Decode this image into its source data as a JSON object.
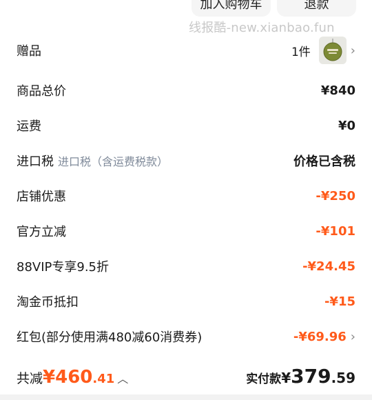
{
  "top_buttons": {
    "add_to_cart": "加入购物车",
    "refund": "退款"
  },
  "watermark": "线报酷-new.xianbao.fun",
  "gift": {
    "label": "赠品",
    "qty": "1件",
    "icon": "gift-ornament-icon"
  },
  "rows": [
    {
      "label": "商品总价",
      "sub": "",
      "value": "¥840",
      "highlight": false
    },
    {
      "label": "运费",
      "sub": "",
      "value": "¥0",
      "highlight": false
    },
    {
      "label": "进口税",
      "sub": "进口税（含运费税款）",
      "value": "价格已含税",
      "highlight": false
    },
    {
      "label": "店铺优惠",
      "sub": "",
      "value": "-¥250",
      "highlight": true
    },
    {
      "label": "官方立减",
      "sub": "",
      "value": "-¥101",
      "highlight": true
    },
    {
      "label": "88VIP专享9.5折",
      "sub": "",
      "value": "-¥24.45",
      "highlight": true
    },
    {
      "label": "淘金币抵扣",
      "sub": "",
      "value": "-¥15",
      "highlight": true
    },
    {
      "label": "红包(部分使用满480减60消费券)",
      "sub": "",
      "value": "-¥69.96",
      "highlight": true
    }
  ],
  "summary": {
    "total_reduce_label": "共减",
    "total_reduce_int": "¥460",
    "total_reduce_dec": ".41",
    "paid_label": "实付款",
    "paid_currency": "¥",
    "paid_int": "379",
    "paid_dec": ".59"
  },
  "colors": {
    "accent": "#ff5a1a",
    "text": "#1a1a1a",
    "muted": "#7f8a9a"
  }
}
